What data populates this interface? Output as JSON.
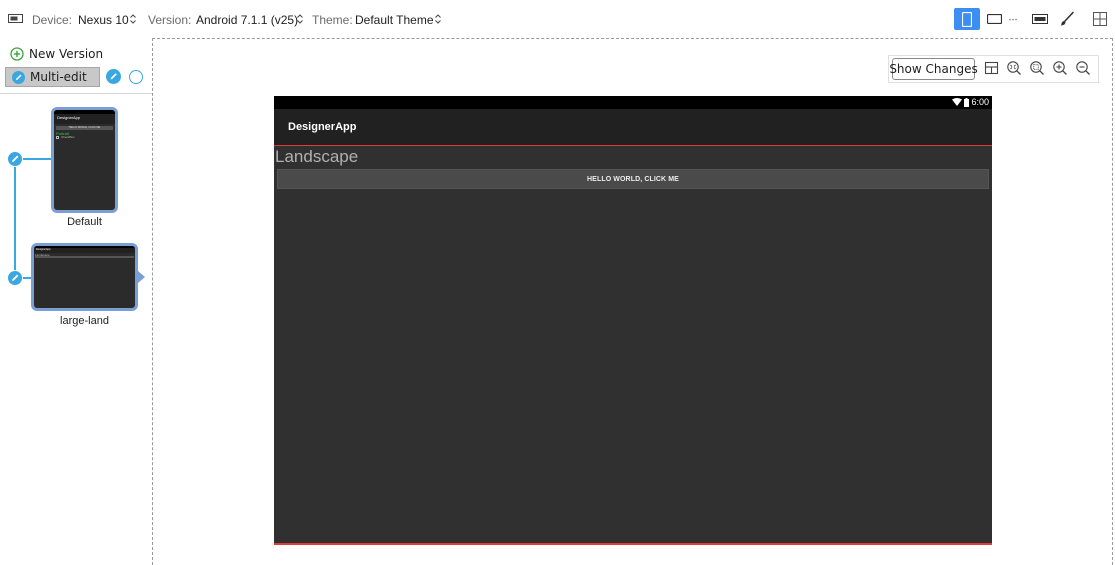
{
  "toolbar": {
    "device_label": "Device:",
    "device_value": "Nexus 10",
    "version_label": "Version:",
    "version_value": "Android 7.1.1 (v25)",
    "theme_label": "Theme:",
    "theme_value": "Default Theme",
    "orientation_selected": "portrait",
    "accent_color": "#3c8ef3"
  },
  "left_panel": {
    "new_version_label": "New Version",
    "multi_edit_label": "Multi-edit",
    "versions": [
      {
        "caption": "Default",
        "orientation": "portrait",
        "mini_title": "DesignerApp",
        "mini_heading": "Portrait",
        "mini_button": "HELLO WORLD, CLICK ME",
        "mini_checkbox": "CheckBox"
      },
      {
        "caption": "large-land",
        "orientation": "landscape",
        "mini_title": "DesignerApp",
        "mini_heading": "Landscape",
        "mini_button": "HELLO WORLD, CLICK ME"
      }
    ],
    "accent_color": "#3ba7e0"
  },
  "canvas": {
    "show_changes_label": "Show Changes",
    "zoom_icons": [
      "toggle-layout-icon",
      "zoom-to-fit-icon",
      "zoom-actual-icon",
      "zoom-in-icon",
      "zoom-out-icon"
    ]
  },
  "device_preview": {
    "status_time": "6:00",
    "app_title": "DesignerApp",
    "heading": "Landscape",
    "button_label": "HELLO WORLD, CLICK ME",
    "background_color": "#303030",
    "appbar_color": "#212121",
    "highlight_color": "#e53935"
  }
}
